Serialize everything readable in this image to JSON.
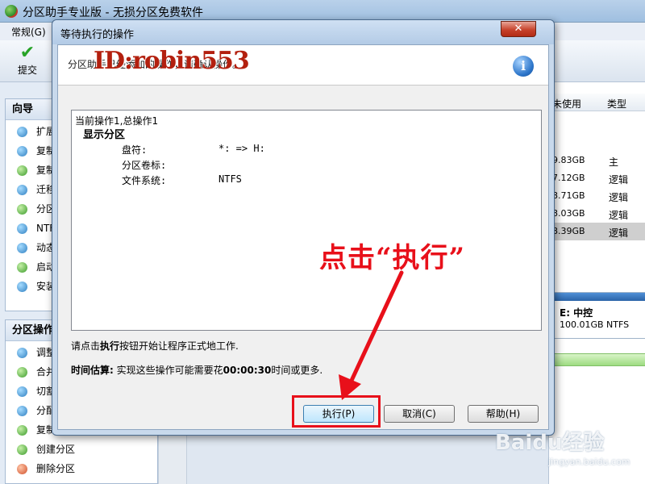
{
  "app": {
    "title": "分区助手专业版 - 无损分区免费软件",
    "menu_general": "常规(G)",
    "toolbar_commit": "提交"
  },
  "wizard_panel": {
    "title": "向导",
    "items": [
      {
        "label": "扩展",
        "icon": "extend-partition-icon"
      },
      {
        "label": "复制",
        "icon": "copy-disk-icon"
      },
      {
        "label": "复制",
        "icon": "copy-partition-icon"
      },
      {
        "label": "迁移",
        "icon": "migrate-os-icon"
      },
      {
        "label": "分区",
        "icon": "partition-recovery-icon"
      },
      {
        "label": "NTF",
        "icon": "ntfs-convert-icon"
      },
      {
        "label": "动态",
        "icon": "dynamic-disk-icon"
      },
      {
        "label": "启动",
        "icon": "boot-disk-icon"
      },
      {
        "label": "安装",
        "icon": "install-icon"
      }
    ]
  },
  "partition_panel": {
    "title": "分区操作",
    "items": [
      {
        "label": "调整",
        "icon": "resize-partition-icon"
      },
      {
        "label": "合并",
        "icon": "merge-partition-icon"
      },
      {
        "label": "切割",
        "icon": "split-partition-icon"
      },
      {
        "label": "分配",
        "icon": "allocate-space-icon"
      },
      {
        "label": "复制",
        "icon": "copy-partition-icon"
      },
      {
        "label": "创建分区",
        "icon": "create-partition-icon"
      },
      {
        "label": "删除分区",
        "icon": "delete-partition-icon"
      }
    ]
  },
  "partition_table": {
    "columns": [
      "未使用",
      "类型"
    ],
    "rows": [
      {
        "free": "9.83GB",
        "type": "主"
      },
      {
        "free": "7.12GB",
        "type": "逻辑"
      },
      {
        "free": "8.71GB",
        "type": "逻辑"
      },
      {
        "free": "8.03GB",
        "type": "逻辑"
      },
      {
        "free": "8.39GB",
        "type": "逻辑",
        "selected": true
      }
    ],
    "disk_label": "E: 中控",
    "disk_size": "100.01GB NTFS"
  },
  "dialog": {
    "title": "等待执行的操作",
    "close_label": "✕",
    "description": "分区助手已经添加的操作，请确认操作。",
    "watermark": "ID:robin553",
    "ops_line": "当前操作1,总操作1",
    "ops_section": "显示分区",
    "ops_rows": [
      {
        "key": "盘符:",
        "value": "*: => H:"
      },
      {
        "key": "分区卷标:",
        "value": ""
      },
      {
        "key": "文件系统:",
        "value": "NTFS"
      }
    ],
    "instruction_pre": "请点击",
    "instruction_bold": "执行",
    "instruction_post": "按钮开始让程序正式地工作.",
    "estimate_label": "时间估算:",
    "estimate_pre": " 实现这些操作可能需要花",
    "estimate_time": "00:00:30",
    "estimate_post": "时间或更多.",
    "buttons": {
      "execute": "执行(P)",
      "cancel": "取消(C)",
      "help": "帮助(H)"
    }
  },
  "annotation": {
    "text": "点击“执行”",
    "color": "#e8101a"
  },
  "watermark_site": {
    "logo": "Baidu经验",
    "url": "jingyan.baidu.com"
  }
}
